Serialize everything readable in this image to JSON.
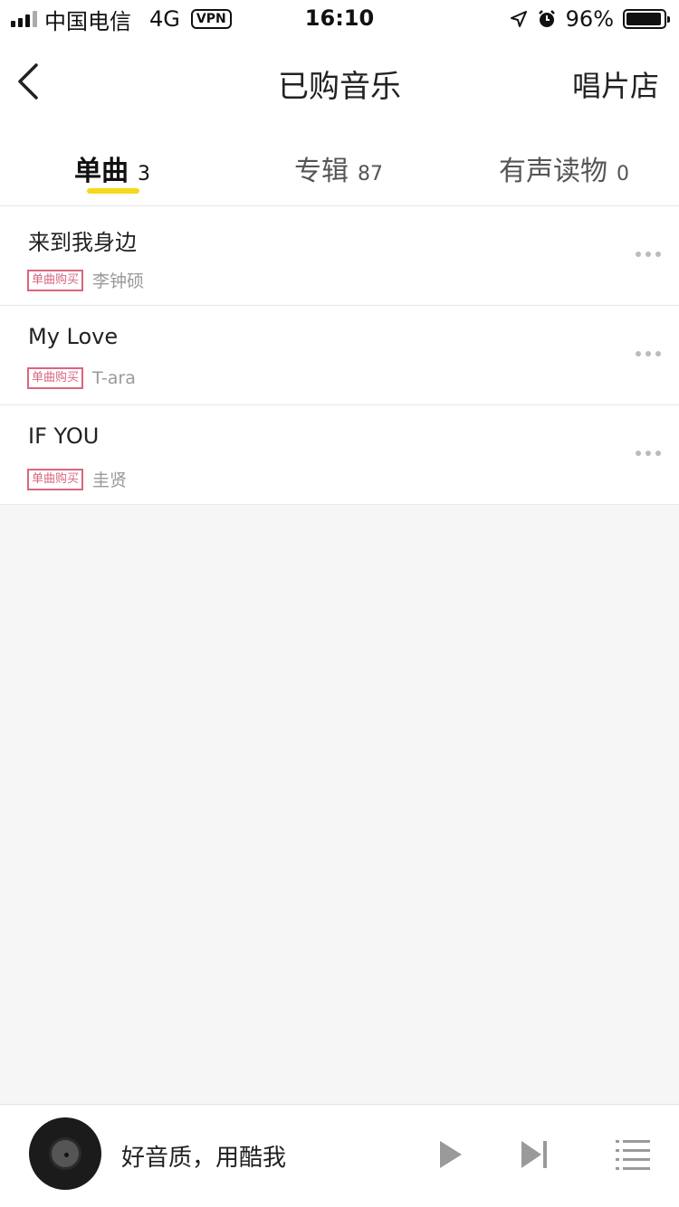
{
  "status_bar": {
    "carrier": "中国电信",
    "network": "4G",
    "vpn": "VPN",
    "time": "16:10",
    "battery": "96%",
    "battery_level": 0.96
  },
  "nav": {
    "title": "已购音乐",
    "right_label": "唱片店",
    "back_icon": "chevron-left-icon"
  },
  "tabs": [
    {
      "label": "单曲",
      "count": "3",
      "active": true
    },
    {
      "label": "专辑",
      "count": "87",
      "active": false
    },
    {
      "label": "有声读物",
      "count": "0",
      "active": false
    }
  ],
  "songs": [
    {
      "title": "来到我身边",
      "badge": "单曲购买",
      "artist": "李钟硕"
    },
    {
      "title": "My Love",
      "badge": "单曲购买",
      "artist": "T-ara"
    },
    {
      "title": "IF YOU",
      "badge": "单曲购买",
      "artist": "圭贤"
    }
  ],
  "player": {
    "text": "好音质，用酷我",
    "icons": [
      "disc-icon",
      "play-icon",
      "next-icon",
      "playlist-icon"
    ]
  },
  "colors": {
    "accent": "#f5d91a",
    "badge": "#d9667f",
    "background": "#f6f6f6"
  }
}
